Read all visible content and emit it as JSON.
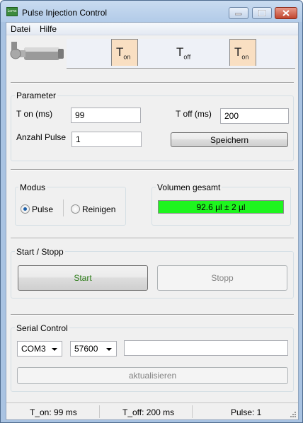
{
  "window": {
    "title": "Pulse Injection Control",
    "icon_text": "Lcms"
  },
  "menu": {
    "items": [
      "Datei",
      "Hilfe"
    ]
  },
  "header": {
    "pulse_labels": [
      {
        "main": "T",
        "sub": "on"
      },
      {
        "main": "T",
        "sub": "off"
      },
      {
        "main": "T",
        "sub": "on"
      }
    ]
  },
  "parameter": {
    "title": "Parameter",
    "t_on_label": "T on (ms)",
    "t_on_value": "99",
    "t_off_label": "T off (ms)",
    "t_off_value": "200",
    "count_label": "Anzahl Pulse",
    "count_value": "1",
    "save_label": "Speichern"
  },
  "modus": {
    "title": "Modus",
    "options": [
      "Pulse",
      "Reinigen"
    ],
    "selected": "Pulse"
  },
  "volume": {
    "title": "Volumen gesamt",
    "value": "92.6 µl ± 2 µl",
    "bar_color": "#1ef51e"
  },
  "startstopp": {
    "title": "Start / Stopp",
    "start_label": "Start",
    "stop_label": "Stopp"
  },
  "serial": {
    "title": "Serial Control",
    "port": "COM3",
    "baud": "57600",
    "input_value": "",
    "refresh_label": "aktualisieren"
  },
  "status": {
    "t_on": "T_on: 99 ms",
    "t_off": "T_off: 200 ms",
    "pulse": "Pulse: 1"
  }
}
